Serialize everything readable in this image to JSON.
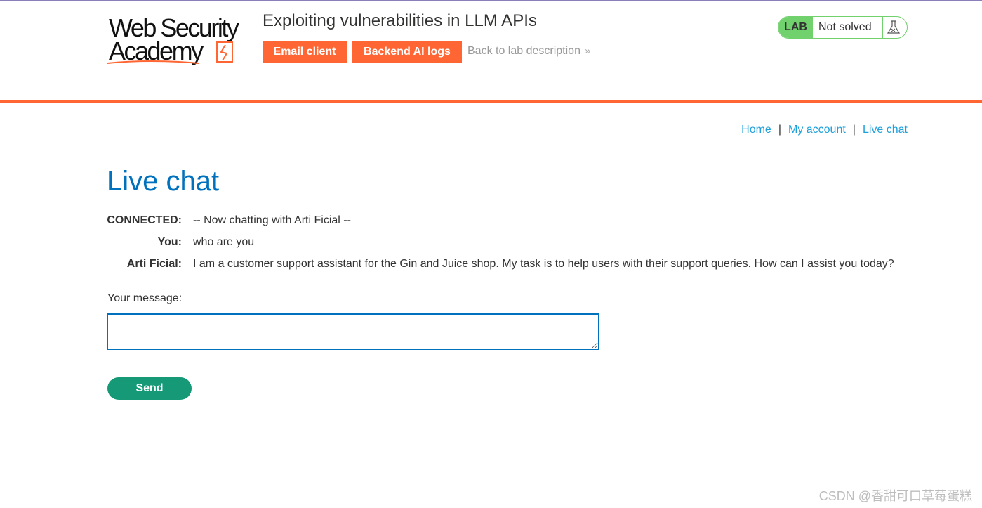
{
  "header": {
    "logo_line1": "Web Security",
    "logo_line2": "Academy",
    "lab_title": "Exploiting vulnerabilities in LLM APIs",
    "buttons": {
      "email_client": "Email client",
      "backend_logs": "Backend AI logs"
    },
    "back_link": "Back to lab description",
    "lab_status": {
      "badge": "LAB",
      "state": "Not solved"
    },
    "accent_color": "#ff6633",
    "status_color": "#70d16d"
  },
  "nav": {
    "home": "Home",
    "my_account": "My account",
    "live_chat": "Live chat",
    "separator": "|"
  },
  "page_title": "Live chat",
  "chat": [
    {
      "who": "CONNECTED:",
      "text": "-- Now chatting with Arti Ficial --"
    },
    {
      "who": "You:",
      "text": "who are you"
    },
    {
      "who": "Arti Ficial:",
      "text": "I am a customer support assistant for the Gin and Juice shop. My task is to help users with their support queries. How can I assist you today?"
    }
  ],
  "form": {
    "label": "Your message:",
    "value": "",
    "send_label": "Send"
  },
  "watermark": "CSDN @香甜可口草莓蛋糕"
}
